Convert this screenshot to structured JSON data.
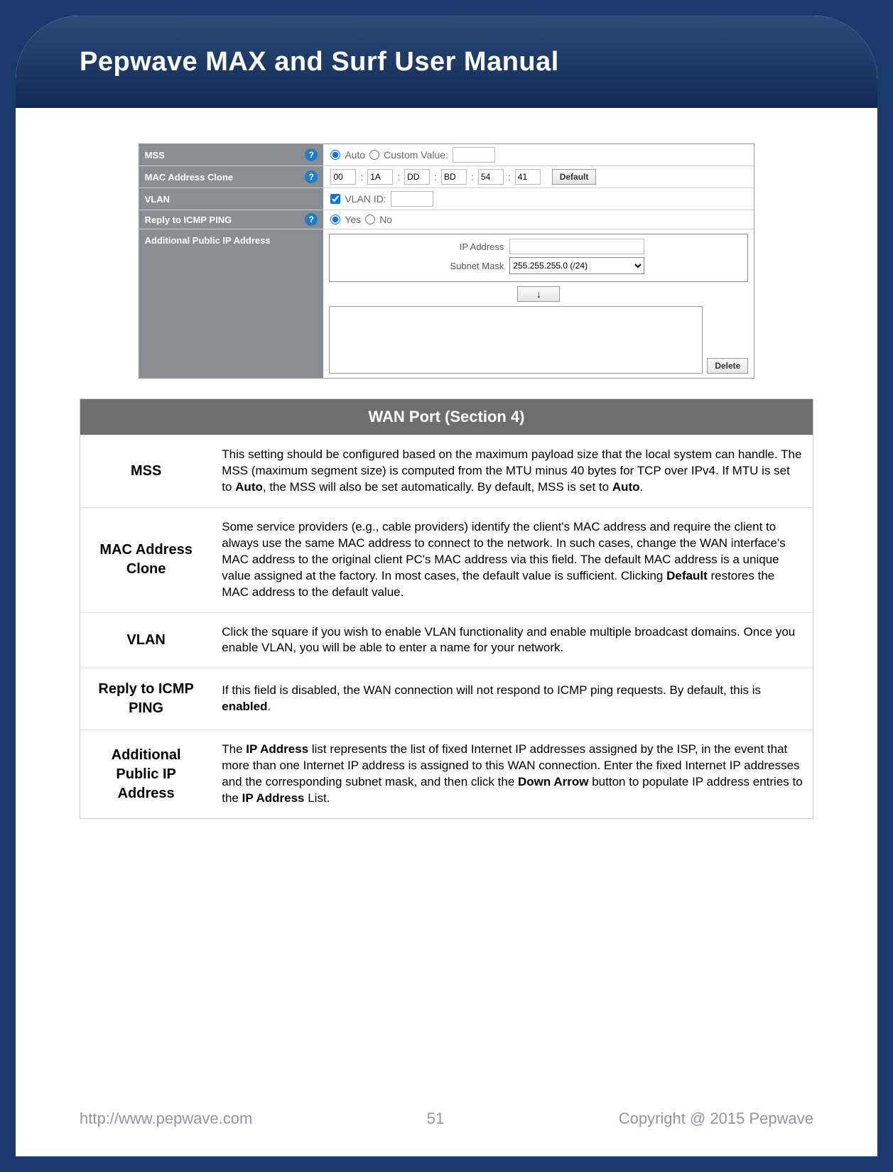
{
  "header": {
    "title": "Pepwave MAX and Surf User Manual"
  },
  "settings_figure": {
    "rows": {
      "mss": {
        "label": "MSS",
        "help": true,
        "auto_label": "Auto",
        "custom_label": "Custom Value:",
        "auto_selected": true
      },
      "mac_clone": {
        "label": "MAC Address Clone",
        "help": true,
        "octets": [
          "00",
          "1A",
          "DD",
          "BD",
          "54",
          "41"
        ],
        "default_btn": "Default"
      },
      "vlan": {
        "label": "VLAN",
        "help": false,
        "checked": true,
        "field_label": "VLAN ID:"
      },
      "icmp": {
        "label": "Reply to ICMP PING",
        "help": true,
        "yes": "Yes",
        "no": "No",
        "yes_selected": true
      },
      "apip": {
        "label": "Additional Public IP Address",
        "ip_label": "IP Address",
        "subnet_label": "Subnet Mask",
        "subnet_value": "255.255.255.0 (/24)",
        "arrow": "↓",
        "delete_btn": "Delete"
      }
    }
  },
  "doc_table": {
    "title": "WAN Port (Section 4)",
    "rows": [
      {
        "term": "MSS",
        "desc": "This setting should be configured based on the maximum payload size that the local system can handle. The MSS (maximum segment size) is computed from the MTU minus 40 bytes for TCP over IPv4. If MTU is set to <b>Auto</b>, the MSS will also be set automatically. By default, MSS is set to <b>Auto</b>."
      },
      {
        "term": "MAC Address Clone",
        "desc": "Some service providers (e.g., cable providers) identify the client's MAC address and require the client to always use the same MAC address to connect to the network. In such cases, change the WAN interface's MAC address to the original client PC's MAC address via this field. The default MAC address is a unique value assigned at the factory. In most cases, the default value is sufficient. Clicking <b>Default</b> restores the MAC address to the default value."
      },
      {
        "term": "VLAN",
        "desc": "Click the square if you wish to enable VLAN functionality and enable multiple broadcast domains. Once you enable VLAN, you will be able to enter a name for your network."
      },
      {
        "term": "Reply to ICMP PING",
        "desc": "If this field is disabled, the WAN connection will not respond to ICMP ping requests. By default, this is <b>enabled</b>."
      },
      {
        "term": "Additional Public IP Address",
        "desc": "The <b>IP Address</b> list represents the list of fixed Internet IP addresses assigned by the ISP, in the event that more than one Internet IP address is assigned to this WAN connection. Enter the fixed Internet IP addresses and the corresponding subnet mask, and then click the <b>Down Arrow</b> button to populate IP address entries to the <b>IP Address</b> List."
      }
    ]
  },
  "footer": {
    "url": "http://www.pepwave.com",
    "page": "51",
    "copyright": "Copyright @ 2015 Pepwave"
  }
}
